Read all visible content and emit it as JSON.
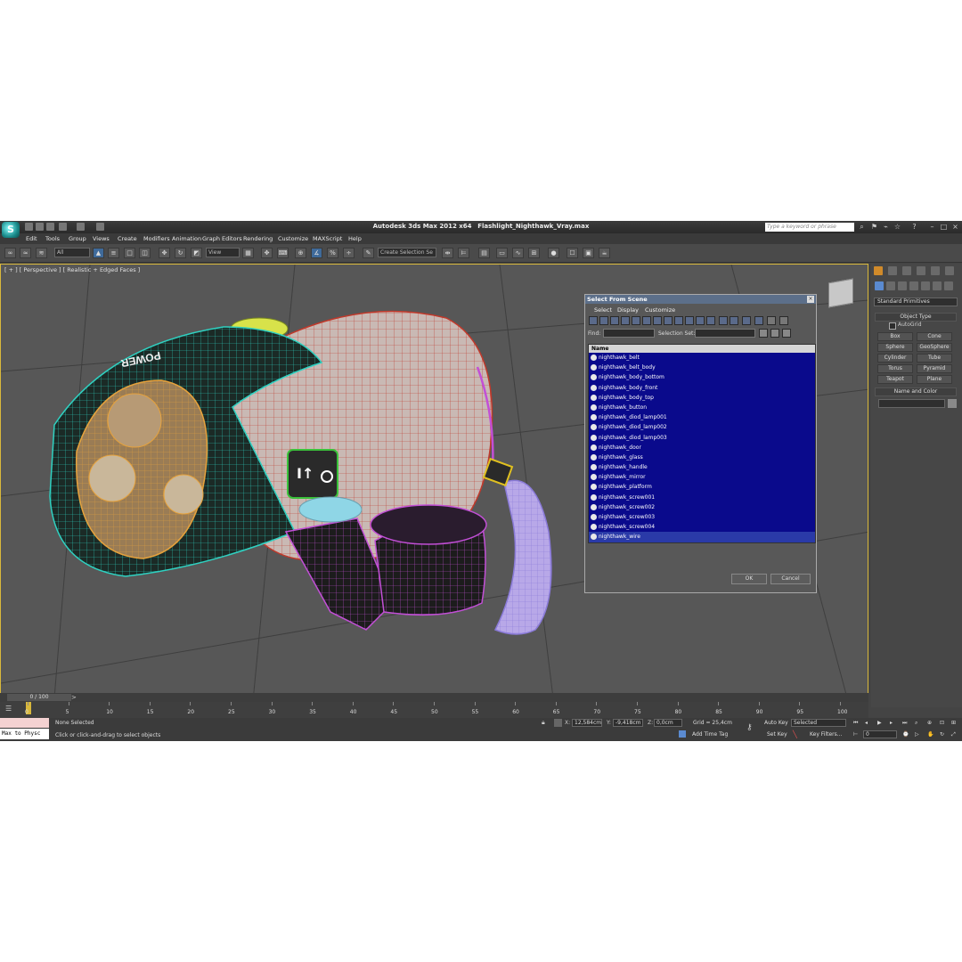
{
  "titlebar": {
    "app_title": "Autodesk 3ds Max  2012 x64",
    "file_name": "Flashlight_Nighthawk_Vray.max",
    "search_placeholder": "Type a keyword or phrase"
  },
  "menu": [
    "Edit",
    "Tools",
    "Group",
    "Views",
    "Create",
    "Modifiers",
    "Animation",
    "Graph Editors",
    "Rendering",
    "Customize",
    "MAXScript",
    "Help"
  ],
  "toolbar": {
    "selection_filter": "All",
    "ref_coord": "View",
    "named_selection": "Create Selection Se"
  },
  "viewport": {
    "label": "[ + ] [ Perspective ] [ Realistic + Edged Faces ]",
    "logo_text": "POWER"
  },
  "dialog": {
    "title": "Select From Scene",
    "menus": [
      "Select",
      "Display",
      "Customize"
    ],
    "find_label": "Find:",
    "selection_set_label": "Selection Set:",
    "column_header": "Name",
    "items": [
      "nighthawk_belt",
      "nighthawk_belt_body",
      "nighthawk_body_bottom",
      "nighthawk_body_front",
      "nighthawk_body_top",
      "nighthawk_button",
      "nighthawk_diod_lamp001",
      "nighthawk_diod_lamp002",
      "nighthawk_diod_lamp003",
      "nighthawk_door",
      "nighthawk_glass",
      "nighthawk_handle",
      "nighthawk_mirror",
      "nighthawk_platform",
      "nighthawk_screw001",
      "nighthawk_screw002",
      "nighthawk_screw003",
      "nighthawk_screw004",
      "nighthawk_wire"
    ],
    "ok": "OK",
    "cancel": "Cancel"
  },
  "command_panel": {
    "category": "Standard Primitives",
    "object_type": "Object Type",
    "autogrid": "AutoGrid",
    "primitives": [
      "Box",
      "Cone",
      "Sphere",
      "GeoSphere",
      "Cylinder",
      "Tube",
      "Torus",
      "Pyramid",
      "Teapot",
      "Plane"
    ],
    "name_and_color": "Name and Color"
  },
  "timeline": {
    "counter": "0 / 100",
    "ticks": [
      "0",
      "5",
      "10",
      "15",
      "20",
      "25",
      "30",
      "35",
      "40",
      "45",
      "50",
      "55",
      "60",
      "65",
      "70",
      "75",
      "80",
      "85",
      "90",
      "95",
      "100"
    ]
  },
  "status": {
    "maxscript": "Max to Physc",
    "selection": "None Selected",
    "prompt": "Click or click-and-drag to select objects",
    "x_label": "X:",
    "x_value": "12,584cm",
    "y_label": "Y:",
    "y_value": "-9,418cm",
    "z_label": "Z:",
    "z_value": "0,0cm",
    "grid": "Grid = 25,4cm",
    "add_time_tag": "Add Time Tag",
    "auto_key": "Auto Key",
    "key_mode": "Selected",
    "set_key": "Set Key",
    "key_filters": "Key Filters...",
    "frame": "0"
  }
}
